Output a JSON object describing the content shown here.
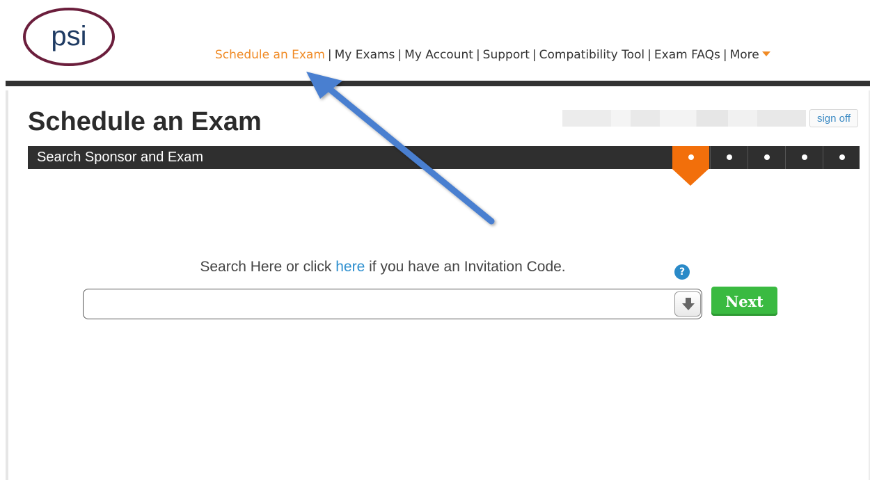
{
  "logo": {
    "text": "psi"
  },
  "nav": {
    "items": [
      "Schedule an Exam",
      "My Exams",
      "My Account",
      "Support",
      "Compatibility Tool",
      "Exam FAQs",
      "More"
    ],
    "active": "Schedule an Exam",
    "separator": "|"
  },
  "page": {
    "title": "Schedule an Exam",
    "sign_off_label": "sign off"
  },
  "steps": {
    "current_title": "Search Sponsor and Exam",
    "count": 5,
    "active_index": 0
  },
  "search": {
    "prompt_before": "Search Here or click ",
    "prompt_link": "here",
    "prompt_after": " if you have an Invitation Code.",
    "help_label": "?",
    "input_value": "",
    "next_label": "Next"
  },
  "colors": {
    "accent": "#f08a24",
    "step_active": "#f26f0b",
    "link": "#2d8fcf",
    "next_button": "#3aba41",
    "annotation_arrow": "#4a7fd0"
  }
}
